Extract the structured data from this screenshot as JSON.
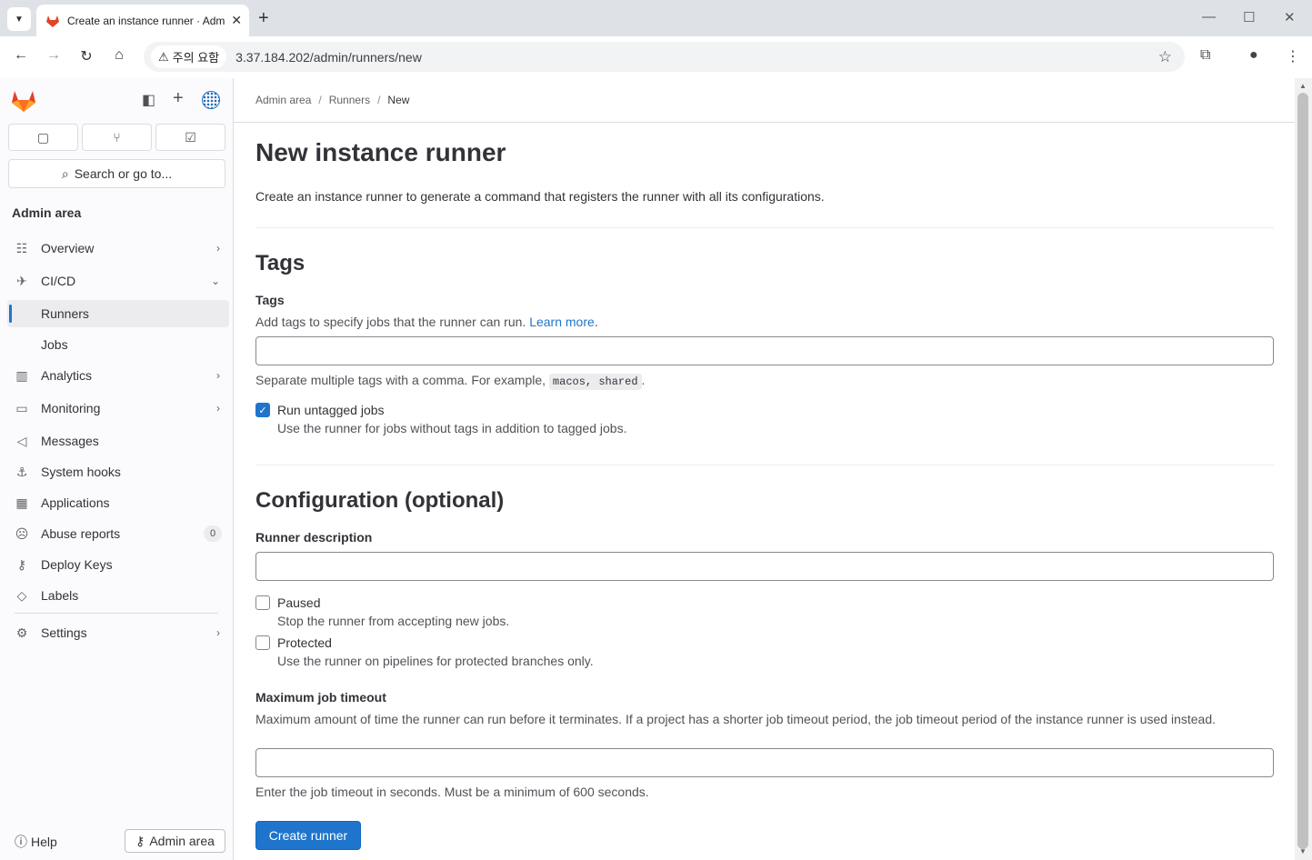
{
  "browser": {
    "tab_title": "Create an instance runner · Admin area · GitLab",
    "security_chip": "주의 요함",
    "url": "3.37.184.202/admin/runners/new"
  },
  "sidebar": {
    "search_placeholder": "Search or go to...",
    "heading": "Admin area",
    "items": [
      {
        "label": "Overview",
        "icon": "overview-icon"
      },
      {
        "label": "CI/CD",
        "icon": "rocket-icon"
      },
      {
        "label": "Runners"
      },
      {
        "label": "Jobs"
      },
      {
        "label": "Analytics",
        "icon": "chart-icon"
      },
      {
        "label": "Monitoring",
        "icon": "monitor-icon"
      },
      {
        "label": "Messages",
        "icon": "bullhorn-icon"
      },
      {
        "label": "System hooks",
        "icon": "anchor-icon"
      },
      {
        "label": "Applications",
        "icon": "applications-icon"
      },
      {
        "label": "Abuse reports",
        "icon": "abuse-icon",
        "badge": "0"
      },
      {
        "label": "Deploy Keys",
        "icon": "key-icon"
      },
      {
        "label": "Labels",
        "icon": "label-icon"
      },
      {
        "label": "Settings",
        "icon": "settings-icon"
      }
    ],
    "help_label": "Help",
    "admin_area_button": "Admin area"
  },
  "breadcrumb": [
    "Admin area",
    "Runners",
    "New"
  ],
  "page": {
    "title": "New instance runner",
    "intro": "Create an instance runner to generate a command that registers the runner with all its configurations.",
    "tags_section": "Tags",
    "tags_label": "Tags",
    "tags_desc": "Add tags to specify jobs that the runner can run.",
    "learn_more": "Learn more",
    "tags_hint_prefix": "Separate multiple tags with a comma. For example,",
    "tags_hint_code": "macos, shared",
    "run_untagged_label": "Run untagged jobs",
    "run_untagged_desc": "Use the runner for jobs without tags in addition to tagged jobs.",
    "config_section": "Configuration (optional)",
    "runner_desc_label": "Runner description",
    "paused_label": "Paused",
    "paused_desc": "Stop the runner from accepting new jobs.",
    "protected_label": "Protected",
    "protected_desc": "Use the runner on pipelines for protected branches only.",
    "timeout_label": "Maximum job timeout",
    "timeout_desc": "Maximum amount of time the runner can run before it terminates. If a project has a shorter job timeout period, the job timeout period of the instance runner is used instead.",
    "timeout_hint": "Enter the job timeout in seconds. Must be a minimum of 600 seconds.",
    "create_button": "Create runner"
  },
  "colors": {
    "primary": "#1f75cb",
    "logo": "#e24329"
  }
}
